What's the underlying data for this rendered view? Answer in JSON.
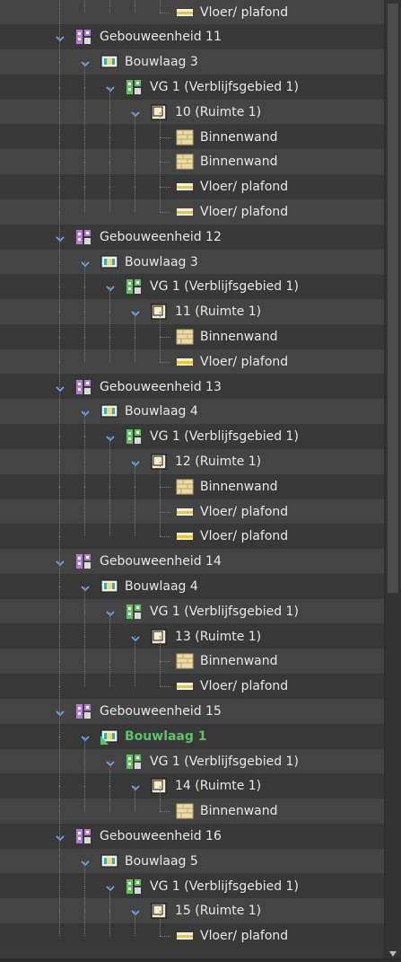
{
  "colors": {
    "highlight": "#5cc36a",
    "chevron": "#6ea8ff",
    "building_icon": "#b57bd6",
    "zone_icon": "#59c75a"
  },
  "rows": [
    {
      "level": 5,
      "type": "floor",
      "label": "Vloer/ plafond",
      "icon": "floor-ceiling-icon"
    },
    {
      "level": 0,
      "type": "unit",
      "label": "Gebouweenheid 11",
      "icon": "building-unit-icon",
      "expanded": true
    },
    {
      "level": 1,
      "type": "layer",
      "label": "Bouwlaag 3",
      "icon": "building-layer-icon",
      "expanded": true
    },
    {
      "level": 2,
      "type": "zone",
      "label": "VG 1 (Verblijfsgebied 1)",
      "icon": "residence-area-icon",
      "expanded": true
    },
    {
      "level": 3,
      "type": "room",
      "label": "10 (Ruimte 1)",
      "icon": "room-icon",
      "expanded": true
    },
    {
      "level": 5,
      "type": "wall",
      "label": "Binnenwand",
      "icon": "inner-wall-icon"
    },
    {
      "level": 5,
      "type": "wall",
      "label": "Binnenwand",
      "icon": "inner-wall-icon"
    },
    {
      "level": 5,
      "type": "floor",
      "label": "Vloer/ plafond",
      "icon": "floor-ceiling-icon"
    },
    {
      "level": 5,
      "type": "floor",
      "label": "Vloer/ plafond",
      "icon": "floor-ceiling-icon"
    },
    {
      "level": 0,
      "type": "unit",
      "label": "Gebouweenheid 12",
      "icon": "building-unit-icon",
      "expanded": true
    },
    {
      "level": 1,
      "type": "layer",
      "label": "Bouwlaag 3",
      "icon": "building-layer-icon",
      "expanded": true
    },
    {
      "level": 2,
      "type": "zone",
      "label": "VG 1 (Verblijfsgebied 1)",
      "icon": "residence-area-icon",
      "expanded": true
    },
    {
      "level": 3,
      "type": "room",
      "label": "11 (Ruimte 1)",
      "icon": "room-icon",
      "expanded": true
    },
    {
      "level": 5,
      "type": "wall",
      "label": "Binnenwand",
      "icon": "inner-wall-icon"
    },
    {
      "level": 5,
      "type": "floor",
      "label": "Vloer/ plafond",
      "icon": "floor-ceiling-icon"
    },
    {
      "level": 0,
      "type": "unit",
      "label": "Gebouweenheid 13",
      "icon": "building-unit-icon",
      "expanded": true
    },
    {
      "level": 1,
      "type": "layer",
      "label": "Bouwlaag 4",
      "icon": "building-layer-icon",
      "expanded": true
    },
    {
      "level": 2,
      "type": "zone",
      "label": "VG 1 (Verblijfsgebied 1)",
      "icon": "residence-area-icon",
      "expanded": true
    },
    {
      "level": 3,
      "type": "room",
      "label": "12 (Ruimte 1)",
      "icon": "room-icon",
      "expanded": true
    },
    {
      "level": 5,
      "type": "wall",
      "label": "Binnenwand",
      "icon": "inner-wall-icon"
    },
    {
      "level": 5,
      "type": "floor",
      "label": "Vloer/ plafond",
      "icon": "floor-ceiling-icon"
    },
    {
      "level": 5,
      "type": "floor",
      "label": "Vloer/ plafond",
      "icon": "floor-ceiling-icon"
    },
    {
      "level": 0,
      "type": "unit",
      "label": "Gebouweenheid 14",
      "icon": "building-unit-icon",
      "expanded": true
    },
    {
      "level": 1,
      "type": "layer",
      "label": "Bouwlaag 4",
      "icon": "building-layer-icon",
      "expanded": true
    },
    {
      "level": 2,
      "type": "zone",
      "label": "VG 1 (Verblijfsgebied 1)",
      "icon": "residence-area-icon",
      "expanded": true
    },
    {
      "level": 3,
      "type": "room",
      "label": "13 (Ruimte 1)",
      "icon": "room-icon",
      "expanded": true
    },
    {
      "level": 5,
      "type": "wall",
      "label": "Binnenwand",
      "icon": "inner-wall-icon"
    },
    {
      "level": 5,
      "type": "floor",
      "label": "Vloer/ plafond",
      "icon": "floor-ceiling-icon"
    },
    {
      "level": 0,
      "type": "unit",
      "label": "Gebouweenheid 15",
      "icon": "building-unit-icon",
      "expanded": true
    },
    {
      "level": 1,
      "type": "layer",
      "label": "Bouwlaag 1",
      "icon": "building-layer-icon",
      "expanded": true,
      "highlight": true
    },
    {
      "level": 2,
      "type": "zone",
      "label": "VG 1 (Verblijfsgebied 1)",
      "icon": "residence-area-icon",
      "expanded": true
    },
    {
      "level": 3,
      "type": "room",
      "label": "14 (Ruimte 1)",
      "icon": "room-icon",
      "expanded": true
    },
    {
      "level": 5,
      "type": "wall",
      "label": "Binnenwand",
      "icon": "inner-wall-icon"
    },
    {
      "level": 0,
      "type": "unit",
      "label": "Gebouweenheid 16",
      "icon": "building-unit-icon",
      "expanded": true
    },
    {
      "level": 1,
      "type": "layer",
      "label": "Bouwlaag 5",
      "icon": "building-layer-icon",
      "expanded": true
    },
    {
      "level": 2,
      "type": "zone",
      "label": "VG 1 (Verblijfsgebied 1)",
      "icon": "residence-area-icon",
      "expanded": true
    },
    {
      "level": 3,
      "type": "room",
      "label": "15 (Ruimte 1)",
      "icon": "room-icon",
      "expanded": true
    },
    {
      "level": 5,
      "type": "floor",
      "label": "Vloer/ plafond",
      "icon": "floor-ceiling-icon"
    }
  ]
}
